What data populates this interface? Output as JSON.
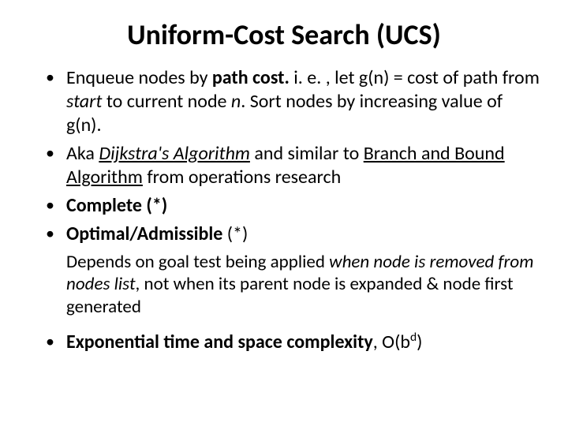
{
  "title": "Uniform-Cost Search (UCS)",
  "bullets": {
    "b1_pre": "Enqueue nodes by ",
    "b1_bold": "path cost.",
    "b1_mid1": " i. e. , let g(n) = cost of path from ",
    "b1_it_start": "start",
    "b1_mid2": " to current node ",
    "b1_it_n": "n",
    "b1_tail": ". Sort nodes by increasing value of g(n).",
    "b2_pre": "Aka ",
    "b2_link1": "Dijkstra's Algorithm",
    "b2_mid": " and similar to ",
    "b2_link2": "Branch and Bound Algorithm",
    "b2_tail": " from operations research",
    "b3": "Complete (*)",
    "b4_bold": "Optimal/Admissible",
    "b4_tail": " (*)",
    "b5_pre": "Exponential time and space complexity",
    "b5_mid": ", O(b",
    "b5_sup": "d",
    "b5_tail": ")"
  },
  "note": {
    "n_pre": "Depends on goal test being applied ",
    "n_it1": "when node is removed from nodes list",
    "n_mid": ", not when its parent node is expanded & node first generated"
  }
}
